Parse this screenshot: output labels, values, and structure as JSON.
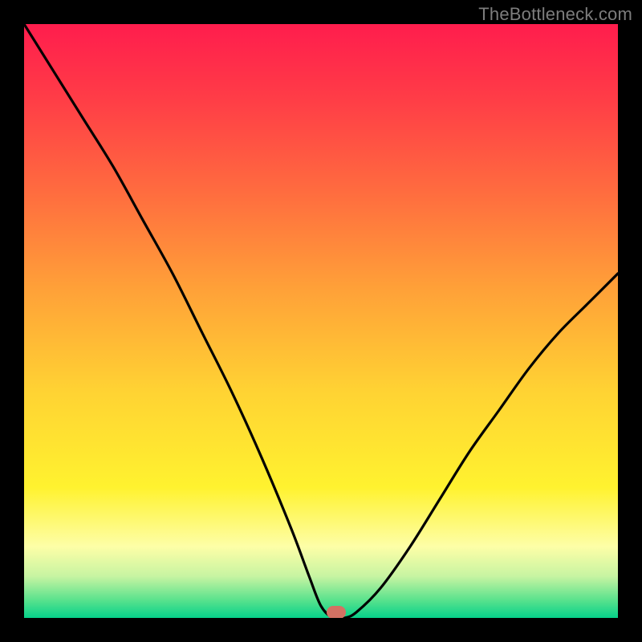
{
  "watermark": "TheBottleneck.com",
  "marker": {
    "x_pct": 52.5,
    "y_pct": 99.0
  },
  "chart_data": {
    "type": "line",
    "title": "",
    "xlabel": "",
    "ylabel": "",
    "xlim": [
      0,
      100
    ],
    "ylim": [
      0,
      100
    ],
    "grid": false,
    "legend": false,
    "annotations": [
      "TheBottleneck.com"
    ],
    "series": [
      {
        "name": "bottleneck-curve",
        "x": [
          0,
          5,
          10,
          15,
          20,
          25,
          30,
          35,
          40,
          45,
          48,
          50,
          52,
          54,
          56,
          60,
          65,
          70,
          75,
          80,
          85,
          90,
          95,
          100
        ],
        "y": [
          100,
          92,
          84,
          76,
          67,
          58,
          48,
          38,
          27,
          15,
          7,
          2,
          0,
          0,
          1,
          5,
          12,
          20,
          28,
          35,
          42,
          48,
          53,
          58
        ]
      }
    ],
    "background_gradient_stops": [
      {
        "pos": 0.0,
        "color": "#ff1d4d"
      },
      {
        "pos": 0.12,
        "color": "#ff3b47"
      },
      {
        "pos": 0.28,
        "color": "#ff6b3f"
      },
      {
        "pos": 0.45,
        "color": "#ffa238"
      },
      {
        "pos": 0.62,
        "color": "#ffd333"
      },
      {
        "pos": 0.78,
        "color": "#fff22f"
      },
      {
        "pos": 0.88,
        "color": "#fdfea7"
      },
      {
        "pos": 0.93,
        "color": "#c7f4a2"
      },
      {
        "pos": 0.97,
        "color": "#59e28d"
      },
      {
        "pos": 1.0,
        "color": "#06d18a"
      }
    ],
    "marker_point": {
      "x": 52.5,
      "y": 0
    }
  }
}
